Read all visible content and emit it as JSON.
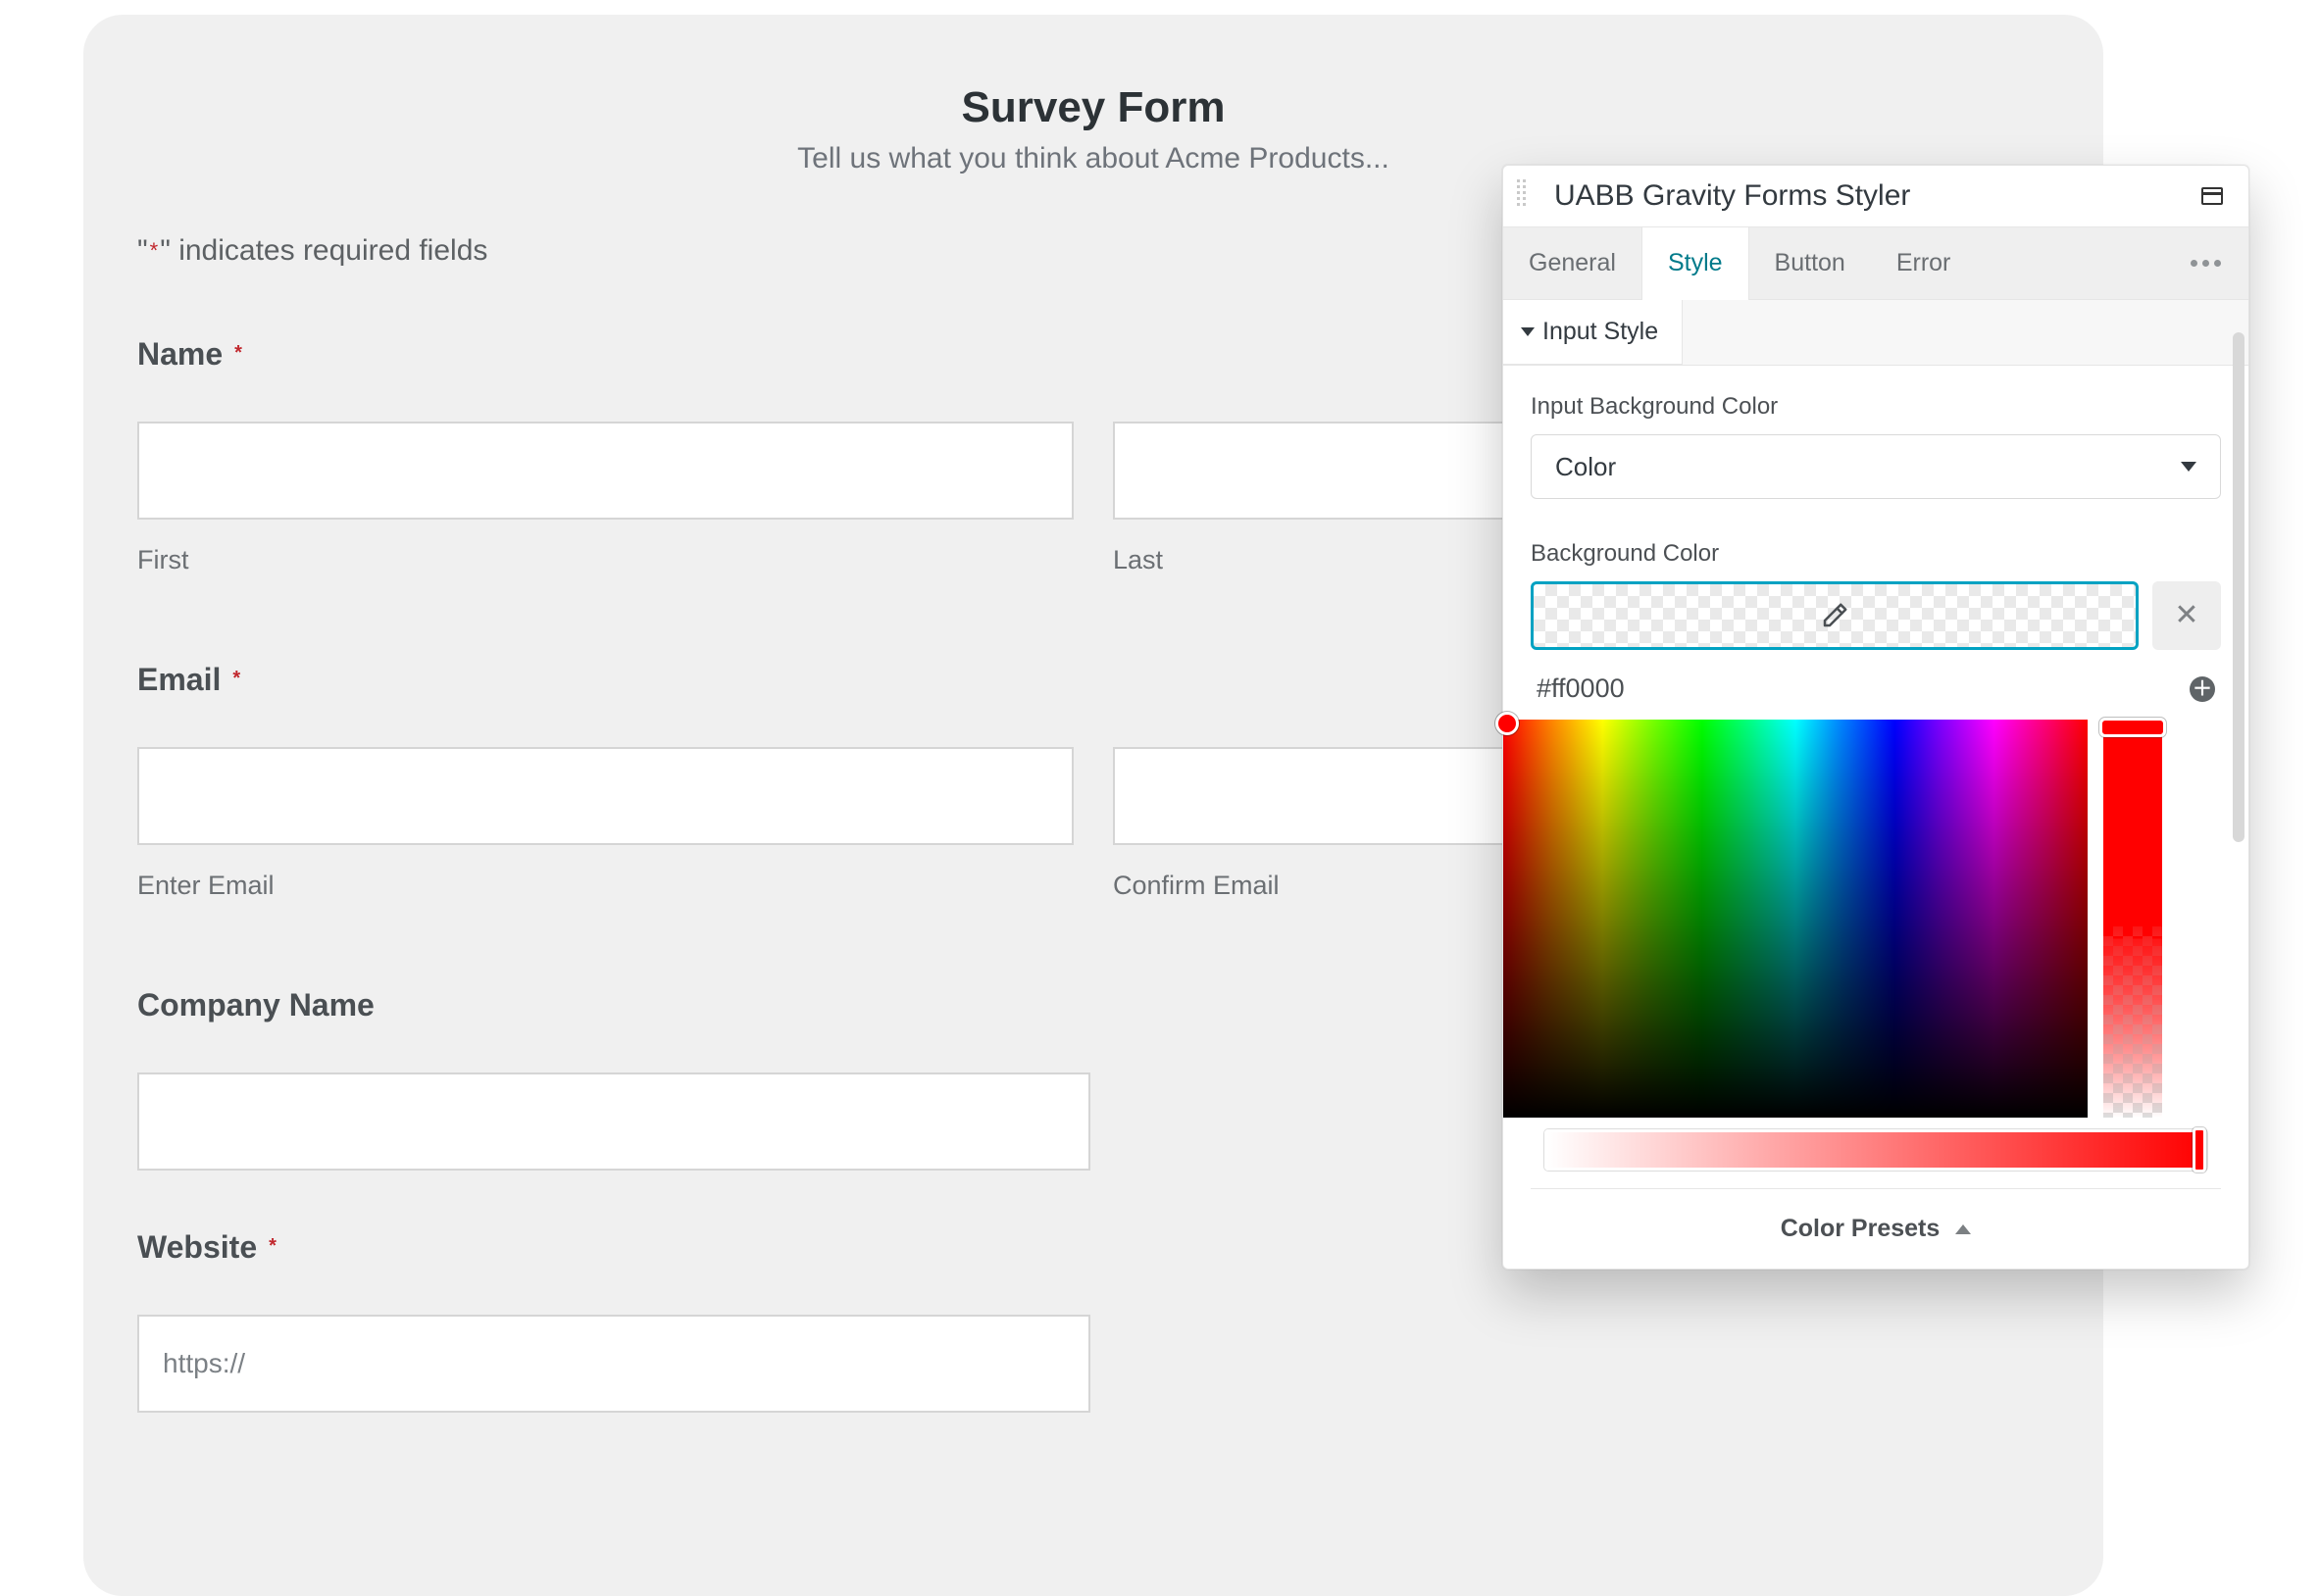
{
  "form": {
    "title": "Survey Form",
    "subtitle": "Tell us what you think about Acme Products...",
    "required_note_prefix": "\"",
    "required_note_star": "*",
    "required_note_suffix": "\" indicates required fields",
    "fields": {
      "name": {
        "label": "Name",
        "required": true,
        "first_sub": "First",
        "last_sub": "Last"
      },
      "email": {
        "label": "Email",
        "required": true,
        "enter_sub": "Enter Email",
        "confirm_sub": "Confirm Email"
      },
      "company": {
        "label": "Company Name",
        "required": false
      },
      "website": {
        "label": "Website",
        "required": true,
        "placeholder": "https://"
      }
    }
  },
  "popover": {
    "title": "UABB Gravity Forms Styler",
    "tabs": {
      "general": "General",
      "style": "Style",
      "button": "Button",
      "error": "Error"
    },
    "active_tab": "style",
    "section": "Input Style",
    "settings": {
      "input_bg_color_label": "Input Background Color",
      "input_bg_color_type": "Color",
      "bg_color_label": "Background Color",
      "hex_value": "#ff0000",
      "presets_label": "Color Presets"
    }
  }
}
